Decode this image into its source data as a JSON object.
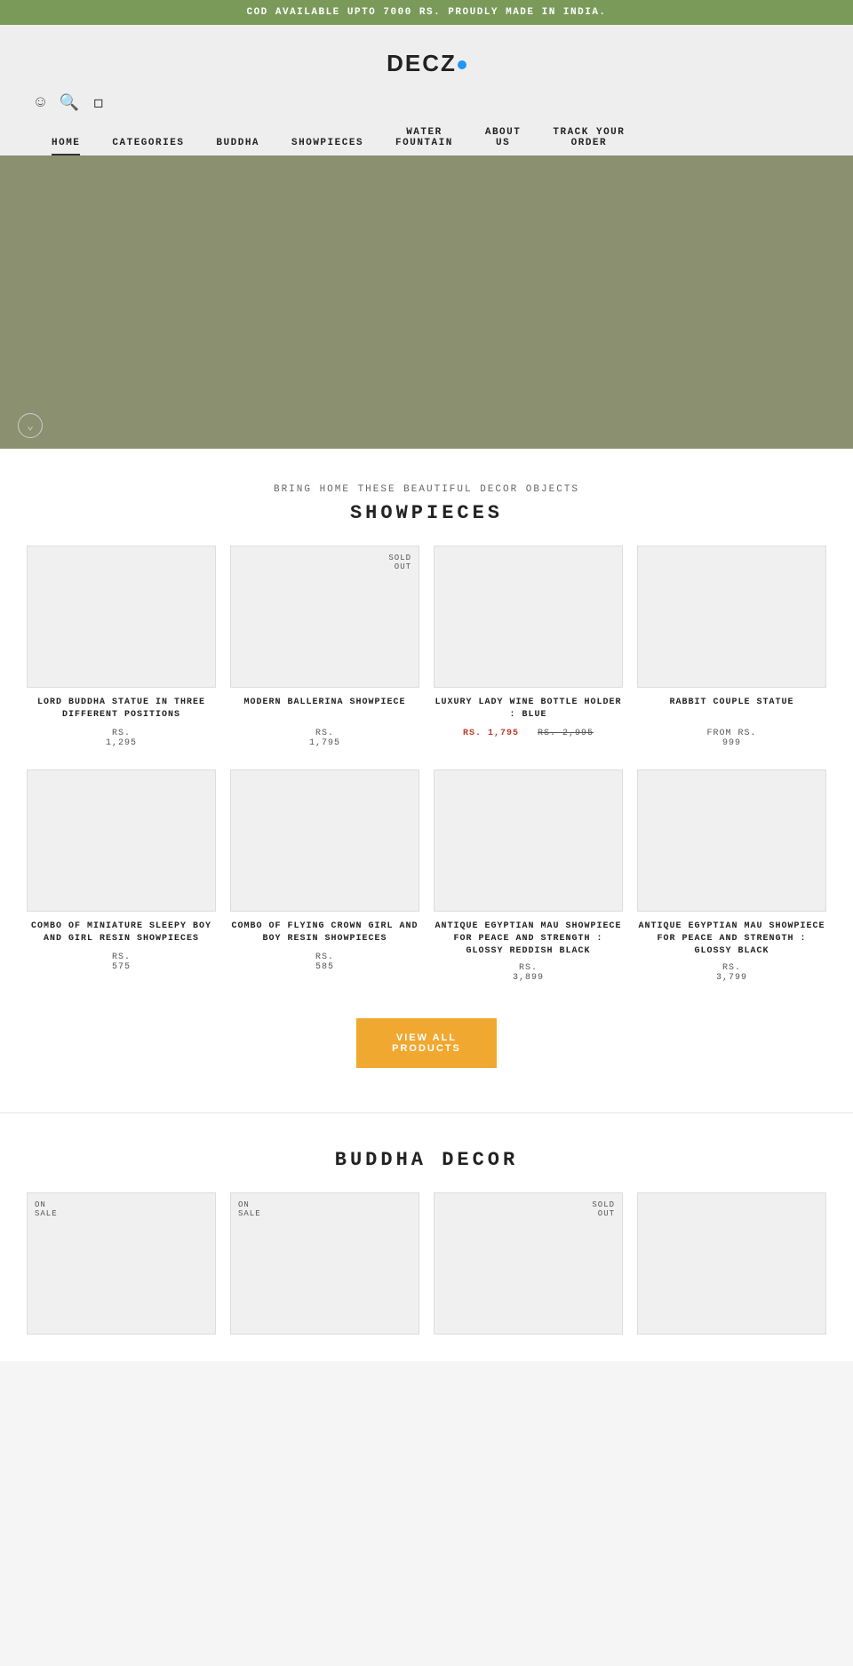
{
  "announcement": {
    "text": "COD AVAILABLE UPTO 7000 RS. PROUDLY MADE IN INDIA."
  },
  "header": {
    "logo": "DECZ",
    "icons": [
      "user-icon",
      "search-icon",
      "cart-icon"
    ],
    "nav": [
      {
        "label": "HOME",
        "active": true
      },
      {
        "label": "CATEGORIES",
        "active": false
      },
      {
        "label": "BUDDHA",
        "active": false
      },
      {
        "label": "SHOWPIECES",
        "active": false
      },
      {
        "label": "WATER\nFOUNTAIN",
        "active": false
      },
      {
        "label": "ABOUT\nUS",
        "active": false
      },
      {
        "label": "TRACK YOUR\nORDER",
        "active": false
      }
    ]
  },
  "showpieces": {
    "subtitle": "BRING HOME THESE BEAUTIFUL DECOR OBJECTS",
    "title": "SHOWPIECES",
    "products": [
      {
        "name": "LORD BUDDHA STATUE IN THREE DIFFERENT POSITIONS",
        "price_label": "RS.",
        "price": "1,295",
        "sale_price": null,
        "original_price": null,
        "sold_out": false,
        "on_sale": false,
        "from": false
      },
      {
        "name": "MODERN BALLERINA SHOWPIECE",
        "price_label": "RS.",
        "price": "1,795",
        "sale_price": null,
        "original_price": null,
        "sold_out": true,
        "on_sale": false,
        "from": false
      },
      {
        "name": "LUXURY LADY WINE BOTTLE HOLDER : BLUE",
        "price_label": null,
        "price": null,
        "sale_price": "RS. 1,795",
        "original_price": "RS. 2,995",
        "sold_out": false,
        "on_sale": false,
        "from": false
      },
      {
        "name": "RABBIT COUPLE STATUE",
        "price_label": "FROM RS.",
        "price": "999",
        "sale_price": null,
        "original_price": null,
        "sold_out": false,
        "on_sale": false,
        "from": true
      }
    ],
    "products_row2": [
      {
        "name": "COMBO OF MINIATURE SLEEPY BOY AND GIRL RESIN SHOWPIECES",
        "price_label": "RS.",
        "price": "575",
        "sale_price": null,
        "original_price": null,
        "sold_out": false,
        "on_sale": false
      },
      {
        "name": "COMBO OF FLYING CROWN GIRL AND BOY RESIN SHOWPIECES",
        "price_label": "RS.",
        "price": "585",
        "sale_price": null,
        "original_price": null,
        "sold_out": false,
        "on_sale": false
      },
      {
        "name": "ANTIQUE EGYPTIAN MAU SHOWPIECE FOR PEACE AND STRENGTH : GLOSSY REDDISH BLACK",
        "price_label": "RS.",
        "price": "3,899",
        "sale_price": null,
        "original_price": null,
        "sold_out": false,
        "on_sale": false
      },
      {
        "name": "ANTIQUE EGYPTIAN MAU SHOWPIECE FOR PEACE AND STRENGTH : GLOSSY BLACK",
        "price_label": "RS.",
        "price": "3,799",
        "sale_price": null,
        "original_price": null,
        "sold_out": false,
        "on_sale": false
      }
    ],
    "view_all_label": "VIEW ALL\nPRODUCTS"
  },
  "buddha": {
    "title": "BUDDHA DECOR",
    "products": [
      {
        "badge": "ON\nSALE",
        "sold_out": false,
        "on_sale": true
      },
      {
        "badge": "ON\nSALE",
        "sold_out": false,
        "on_sale": true
      },
      {
        "badge": "SOLD\nOUT",
        "sold_out": true,
        "on_sale": false
      },
      {
        "badge": "",
        "sold_out": false,
        "on_sale": false
      }
    ]
  }
}
